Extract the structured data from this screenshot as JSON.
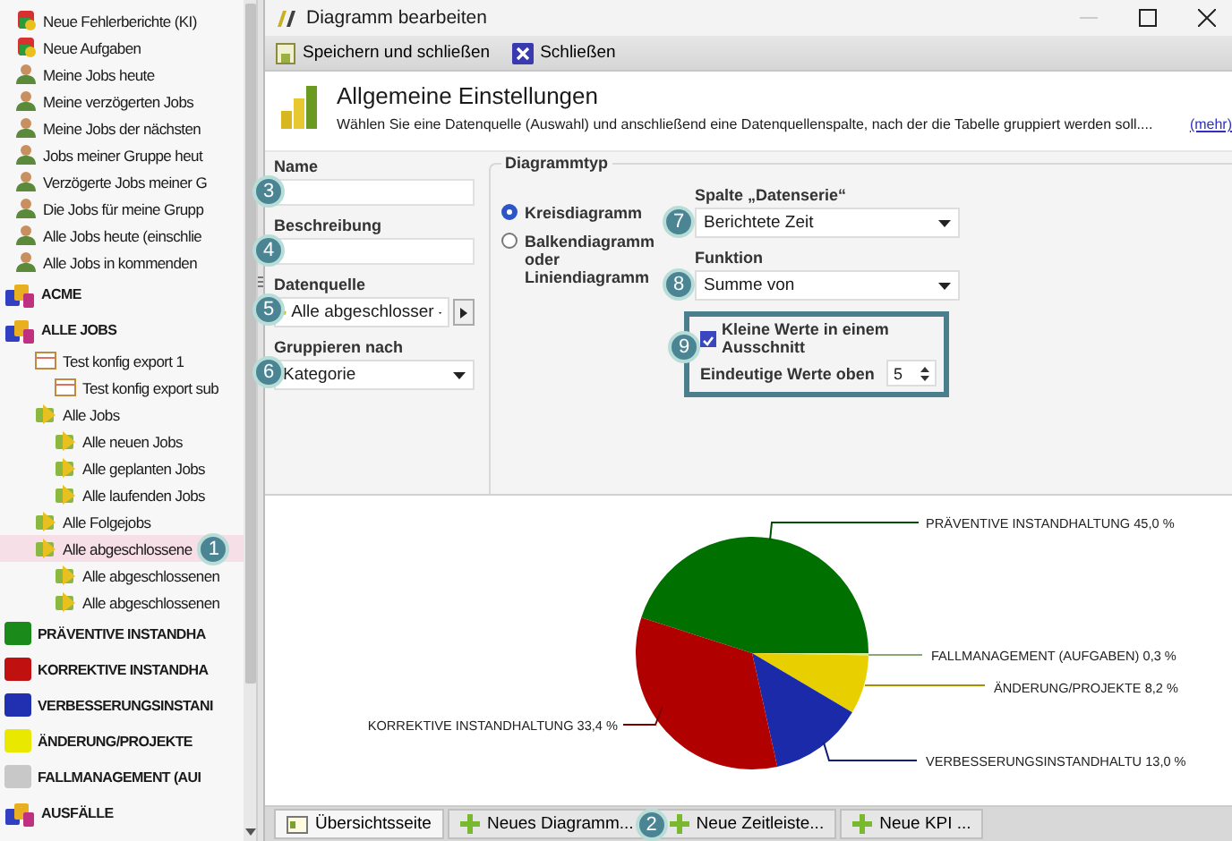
{
  "sidebar": {
    "items": [
      {
        "label": "Neue Fehlerberichte (KI)",
        "kind": "flag",
        "selected": false
      },
      {
        "label": "Neue Aufgaben",
        "kind": "flag",
        "selected": false
      },
      {
        "label": "Meine Jobs heute",
        "kind": "person",
        "selected": false
      },
      {
        "label": "Meine verzögerten Jobs",
        "kind": "person",
        "selected": false
      },
      {
        "label": "Meine Jobs der nächsten",
        "kind": "person",
        "selected": false
      },
      {
        "label": "Jobs meiner Gruppe heut",
        "kind": "person",
        "selected": false
      },
      {
        "label": "Verzögerte Jobs meiner G",
        "kind": "person",
        "selected": false
      },
      {
        "label": "Die Jobs für meine Grupp",
        "kind": "person",
        "selected": false
      },
      {
        "label": "Alle Jobs heute (einschlie",
        "kind": "person",
        "selected": false
      },
      {
        "label": "Alle Jobs in kommenden",
        "kind": "person",
        "selected": false
      },
      {
        "label": "ACME",
        "kind": "group",
        "selected": false
      },
      {
        "label": "ALLE JOBS",
        "kind": "group",
        "selected": false,
        "children": [
          {
            "label": "Test konfig export 1",
            "kind": "table",
            "selected": false,
            "children": [
              {
                "label": "Test konfig export sub",
                "kind": "table",
                "selected": false
              }
            ]
          },
          {
            "label": "Alle Jobs",
            "kind": "jobs",
            "selected": false,
            "children": [
              {
                "label": "Alle neuen Jobs",
                "kind": "jobs",
                "selected": false
              },
              {
                "label": "Alle geplanten Jobs",
                "kind": "jobs",
                "selected": false
              },
              {
                "label": "Alle laufenden Jobs",
                "kind": "jobs",
                "selected": false
              }
            ]
          },
          {
            "label": "Alle Folgejobs",
            "kind": "jobs",
            "selected": false
          },
          {
            "label": "Alle abgeschlossene",
            "kind": "jobs",
            "selected": true,
            "callout": "1",
            "children": [
              {
                "label": "Alle abgeschlossenen",
                "kind": "jobs",
                "selected": false
              },
              {
                "label": "Alle abgeschlossenen",
                "kind": "jobs",
                "selected": false
              }
            ]
          }
        ]
      },
      {
        "label": "PRÄVENTIVE INSTANDHA",
        "kind": "category",
        "color": "#1a8a1a",
        "selected": false
      },
      {
        "label": "KORREKTIVE INSTANDHA",
        "kind": "category",
        "color": "#c01010",
        "selected": false
      },
      {
        "label": "VERBESSERUNGSINSTANI",
        "kind": "category",
        "color": "#2030b0",
        "selected": false
      },
      {
        "label": "ÄNDERUNG/PROJEKTE",
        "kind": "category",
        "color": "#e8e800",
        "selected": false
      },
      {
        "label": "FALLMANAGEMENT (AUI",
        "kind": "category",
        "color": "#c8c8c8",
        "selected": false
      },
      {
        "label": "AUSFÄLLE",
        "kind": "group",
        "selected": false
      }
    ]
  },
  "window": {
    "title": "Diagramm bearbeiten"
  },
  "toolbar": {
    "buttons": [
      {
        "label": "Speichern und schließen",
        "kind": "save"
      },
      {
        "label": "Schließen",
        "kind": "close"
      }
    ]
  },
  "header": {
    "title": "Allgemeine Einstellungen",
    "description": "Wählen Sie eine Datenquelle (Auswahl) und anschließend eine Datenquellenspalte, nach der die Tabelle gruppiert werden soll....",
    "more_link": "(mehr)"
  },
  "form": {
    "fields": [
      {
        "label": "Name",
        "kind": "text",
        "callout": "3"
      },
      {
        "label": "Beschreibung",
        "kind": "text",
        "callout": "4"
      },
      {
        "label": "Datenquelle",
        "kind": "source",
        "value": "Alle abgeschlosser",
        "callout": "5"
      },
      {
        "label": "Gruppieren nach",
        "kind": "select",
        "value": "Kategorie",
        "callout": "6"
      }
    ]
  },
  "chart_type": {
    "title": "Diagrammtyp",
    "options": [
      {
        "label": "Kreisdiagramm",
        "selected": true
      },
      {
        "label": "Balkendiagramm oder Liniendiagramm",
        "selected": false
      }
    ],
    "series_column": {
      "label": "Spalte „Datenserie“",
      "value": "Berichtete Zeit",
      "callout": "7"
    },
    "function": {
      "label": "Funktion",
      "value": "Summe von",
      "callout": "8"
    },
    "small_values": {
      "callout": "9",
      "checkbox": {
        "label": "Kleine Werte in einem Ausschnitt",
        "checked": true
      },
      "spinner": {
        "label": "Eindeutige Werte oben",
        "value": "5"
      }
    }
  },
  "chart": {
    "chart_data": {
      "type": "pie",
      "categories": [
        "PRÄVENTIVE INSTANDHALTUNG",
        "FALLMANAGEMENT (AUFGABEN)",
        "ÄNDERUNG/PROJEKTE",
        "VERBESSERUNGSINSTANDHALTU",
        "KORREKTIVE INSTANDHALTUNG"
      ],
      "values": [
        45.0,
        0.3,
        8.2,
        13.0,
        33.4
      ],
      "colors": [
        "#007000",
        "#c8f0a0",
        "#e8d000",
        "#1a2aa8",
        "#b00000"
      ],
      "value_labels": [
        "45,0 %",
        "0,3 %",
        "8,2 %",
        "13,0 %",
        "33,4 %"
      ]
    }
  },
  "bottom_tabs": [
    {
      "label": "Übersichtsseite",
      "kind": "page",
      "selected": true
    },
    {
      "label": "Neues Diagramm...",
      "kind": "new",
      "selected": false,
      "callout": "2"
    },
    {
      "label": "Neue Zeitleiste...",
      "kind": "new",
      "selected": false
    },
    {
      "label": "Neue KPI ...",
      "kind": "new",
      "selected": false
    }
  ]
}
